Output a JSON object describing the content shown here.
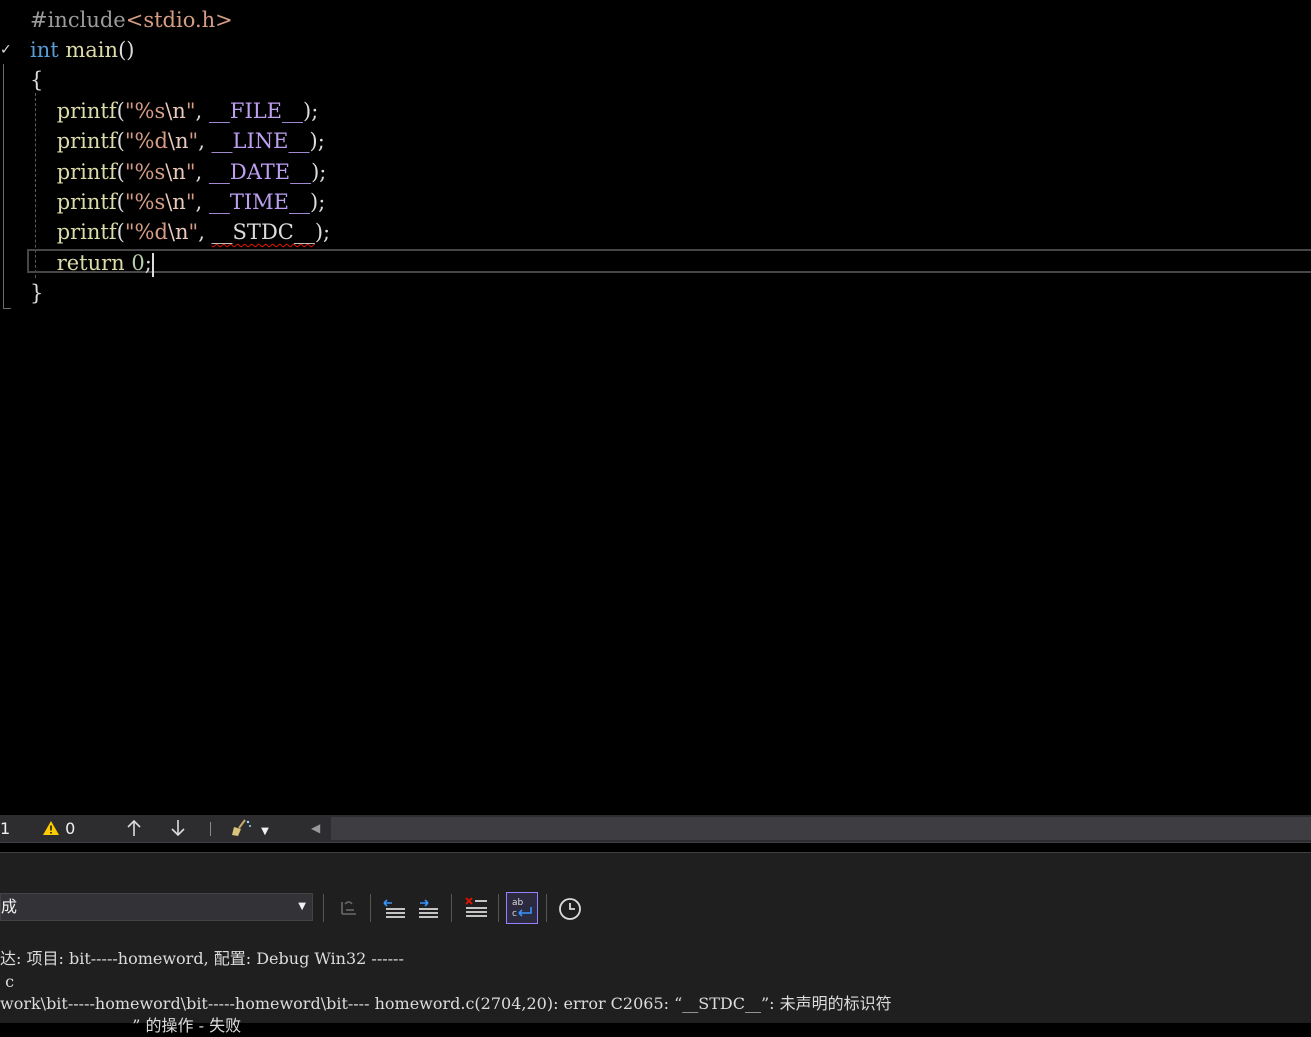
{
  "editor": {
    "lines": [
      [
        {
          "t": "#include",
          "c": "pp"
        },
        {
          "t": "<stdio.h>",
          "c": "str"
        }
      ],
      [
        {
          "t": "int",
          "c": "kw"
        },
        {
          "t": " ",
          "c": "pl"
        },
        {
          "t": "main",
          "c": "fn"
        },
        {
          "t": "()",
          "c": "pl"
        }
      ],
      [
        {
          "t": "{",
          "c": "pl"
        }
      ],
      [
        {
          "t": "    ",
          "c": "pl"
        },
        {
          "t": "printf",
          "c": "fn"
        },
        {
          "t": "(",
          "c": "pl"
        },
        {
          "t": "\"%s",
          "c": "str"
        },
        {
          "t": "\\n",
          "c": "esc"
        },
        {
          "t": "\"",
          "c": "str"
        },
        {
          "t": ", ",
          "c": "pl"
        },
        {
          "t": "__FILE__",
          "c": "mac"
        },
        {
          "t": ");",
          "c": "pl"
        }
      ],
      [
        {
          "t": "    ",
          "c": "pl"
        },
        {
          "t": "printf",
          "c": "fn"
        },
        {
          "t": "(",
          "c": "pl"
        },
        {
          "t": "\"%d",
          "c": "str"
        },
        {
          "t": "\\n",
          "c": "esc"
        },
        {
          "t": "\"",
          "c": "str"
        },
        {
          "t": ", ",
          "c": "pl"
        },
        {
          "t": "__LINE__",
          "c": "mac"
        },
        {
          "t": ");",
          "c": "pl"
        }
      ],
      [
        {
          "t": "    ",
          "c": "pl"
        },
        {
          "t": "printf",
          "c": "fn"
        },
        {
          "t": "(",
          "c": "pl"
        },
        {
          "t": "\"%s",
          "c": "str"
        },
        {
          "t": "\\n",
          "c": "esc"
        },
        {
          "t": "\"",
          "c": "str"
        },
        {
          "t": ", ",
          "c": "pl"
        },
        {
          "t": "__DATE__",
          "c": "mac"
        },
        {
          "t": ");",
          "c": "pl"
        }
      ],
      [
        {
          "t": "    ",
          "c": "pl"
        },
        {
          "t": "printf",
          "c": "fn"
        },
        {
          "t": "(",
          "c": "pl"
        },
        {
          "t": "\"%s",
          "c": "str"
        },
        {
          "t": "\\n",
          "c": "esc"
        },
        {
          "t": "\"",
          "c": "str"
        },
        {
          "t": ", ",
          "c": "pl"
        },
        {
          "t": "__TIME__",
          "c": "mac"
        },
        {
          "t": ");",
          "c": "pl"
        }
      ],
      [
        {
          "t": "    ",
          "c": "pl"
        },
        {
          "t": "printf",
          "c": "fn"
        },
        {
          "t": "(",
          "c": "pl"
        },
        {
          "t": "\"%d",
          "c": "str"
        },
        {
          "t": "\\n",
          "c": "esc"
        },
        {
          "t": "\"",
          "c": "str"
        },
        {
          "t": ", ",
          "c": "pl"
        },
        {
          "t": "__STDC__",
          "c": "pl err"
        },
        {
          "t": ");",
          "c": "pl"
        }
      ],
      [
        {
          "t": "    ",
          "c": "pl"
        },
        {
          "t": "return",
          "c": "fn"
        },
        {
          "t": " ",
          "c": "pl"
        },
        {
          "t": "0",
          "c": "num"
        },
        {
          "t": ";",
          "c": "pl"
        },
        {
          "t": "|caret|",
          "c": "caret"
        }
      ],
      [
        {
          "t": "}",
          "c": "pl"
        }
      ]
    ]
  },
  "status": {
    "errors_count": "1",
    "warnings_count": "0"
  },
  "output": {
    "source_select": "成",
    "lines": [
      "达: 项目: bit-----homeword, 配置: Debug Win32 ------",
      " c",
      "work\\bit-----homeword\\bit-----homeword\\bit---- homeword.c(2704,20): error C2065: “__STDC__”: 未声明的标识符",
      "                          ” 的操作 - 失败"
    ]
  },
  "colors": {
    "editor_bg": "#000000",
    "keyword": "#569cd6",
    "function": "#dcdcaa",
    "string": "#d69d85",
    "macro": "#bd9ff0",
    "error_squiggle": "#e51400"
  }
}
